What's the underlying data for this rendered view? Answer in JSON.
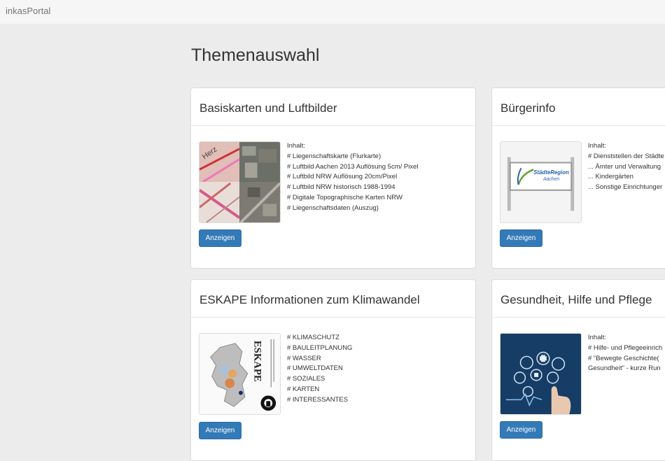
{
  "app": {
    "brand": "inkasPortal"
  },
  "page": {
    "title": "Themenauswahl"
  },
  "cards": [
    {
      "title": "Basiskarten und Luftbilder",
      "lines": [
        "Inhalt:",
        "# Liegenschaftskarte (Flurkarte)",
        "# Luftbild Aachen 2013 Auflösung 5cm/ Pixel",
        "# Luftbild NRW Auflösung 20cm/Pixel",
        "# Luftbild NRW historisch 1988-1994",
        "# Digitale Topographische Karten NRW",
        "# Liegenschaftsdaten (Auszug)"
      ],
      "button": "Anzeigen"
    },
    {
      "title": "Bürgerinfo",
      "lines": [
        "Inhalt:",
        "# Dienststellen der Städte",
        "... Ämter und Verwaltung",
        "... Kindergärten",
        "... Sonstige Einrichtunger"
      ],
      "button": "Anzeigen",
      "thumb_text": [
        "StädteRegion",
        "Aachen"
      ]
    },
    {
      "title": "ESKAPE Informationen zum Klimawandel",
      "lines": [
        "# KLIMASCHUTZ",
        "# BAULEITPLANUNG",
        "# WASSER",
        "# UMWELTDATEN",
        "# SOZIALES",
        "# KARTEN",
        "# INTERESSANTES"
      ],
      "button": "Anzeigen",
      "thumb_text": [
        "ESKAPE"
      ]
    },
    {
      "title": "Gesundheit, Hilfe und Pflege",
      "lines": [
        "Inhalt:",
        "# Hilfe- und Pflegeeinrich",
        "# \"Bewegte Geschichte(",
        "Gesundheit\" - kurze Run"
      ],
      "button": "Anzeigen"
    }
  ],
  "colors": {
    "button": "#337ab7",
    "background": "#ececec",
    "card": "#ffffff"
  }
}
